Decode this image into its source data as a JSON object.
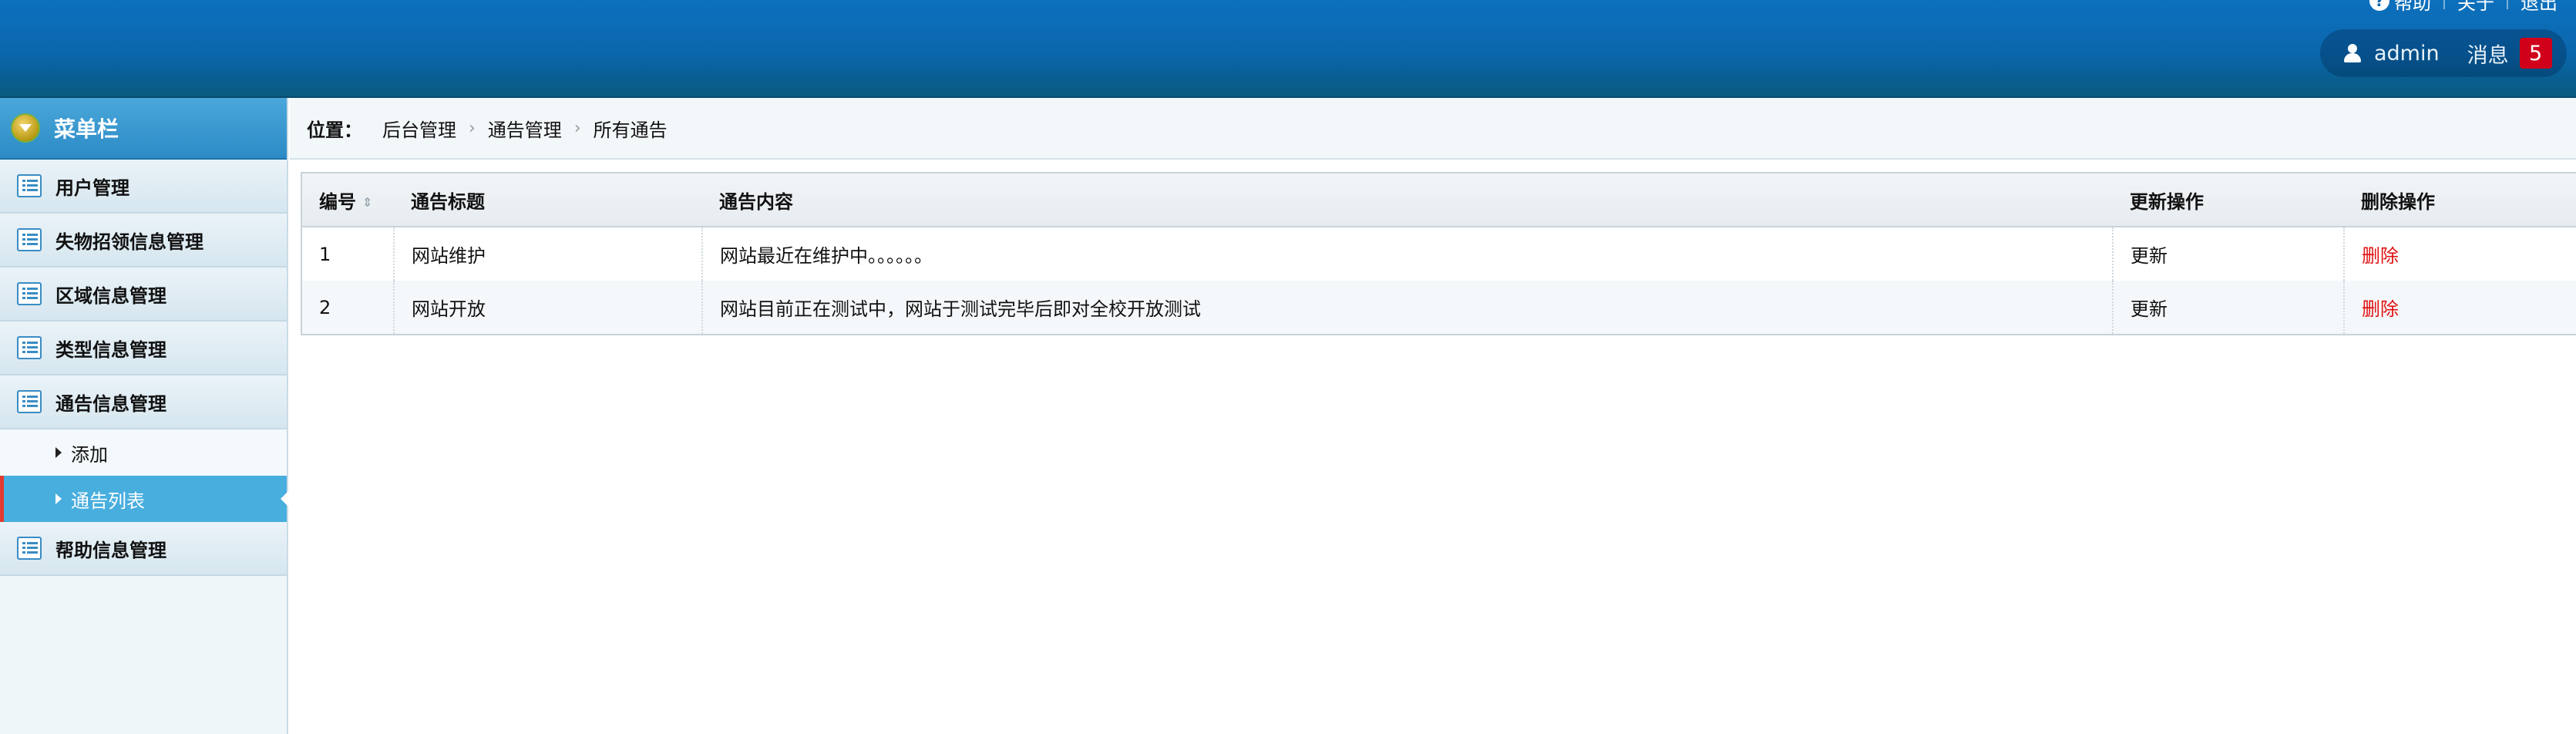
{
  "header": {
    "links": {
      "help": "帮助",
      "about": "关于",
      "logout": "退出"
    },
    "user": {
      "name": "admin",
      "messages_label": "消息",
      "messages_count": "5"
    }
  },
  "sidebar": {
    "title": "菜单栏",
    "groups": [
      {
        "label": "用户管理"
      },
      {
        "label": "失物招领信息管理"
      },
      {
        "label": "区域信息管理"
      },
      {
        "label": "类型信息管理"
      },
      {
        "label": "通告信息管理",
        "children": [
          {
            "label": "添加"
          },
          {
            "label": "通告列表",
            "active": true
          }
        ]
      },
      {
        "label": "帮助信息管理"
      }
    ]
  },
  "breadcrumb": {
    "label": "位置：",
    "items": [
      "后台管理",
      "通告管理",
      "所有通告"
    ]
  },
  "table": {
    "headers": [
      "编号",
      "通告标题",
      "通告内容",
      "更新操作",
      "删除操作"
    ],
    "rows": [
      [
        "1",
        "网站维护",
        "网站最近在维护中。。。。。。",
        "更新",
        "删除"
      ],
      [
        "2",
        "网站开放",
        "网站目前正在测试中，网站于测试完毕后即对全校开放测试",
        "更新",
        "删除"
      ]
    ]
  },
  "colors": {
    "header_blue": "#0a67ad",
    "active_item": "#48aede",
    "delete_red": "#e01010",
    "badge_red": "#d0001a"
  }
}
